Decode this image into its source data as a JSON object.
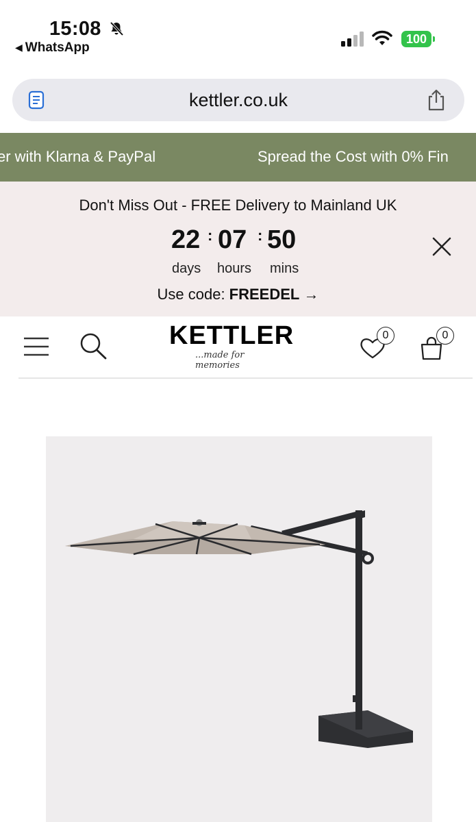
{
  "status_bar": {
    "time": "15:08",
    "back_app": "WhatsApp",
    "battery": "100",
    "icons": [
      "bell-muted-icon",
      "signal-icon",
      "wifi-icon",
      "battery-icon"
    ]
  },
  "browser": {
    "url": "kettler.co.uk",
    "reader_icon": "reader-mode-icon",
    "share_icon": "share-icon"
  },
  "marquee": {
    "item_1": "er with Klarna & PayPal",
    "item_2": "Spread the Cost with 0% Fin",
    "color": "#7a8862"
  },
  "promo": {
    "headline": "Don't Miss Out - FREE Delivery to Mainland UK",
    "countdown": {
      "days": "22",
      "hours": "07",
      "mins": "50",
      "days_label": "days",
      "hours_label": "hours",
      "mins_label": "mins",
      "separator": ":"
    },
    "code_prefix": "Use code: ",
    "code": "FREEDEL",
    "code_arrow": "→",
    "close_icon": "close-icon",
    "background": "#f3ecec"
  },
  "header": {
    "logo_text": "KETTLER",
    "tagline": "...made for memories",
    "wishlist_count": "0",
    "bag_count": "0",
    "icons": [
      "menu-icon",
      "search-icon",
      "heart-icon",
      "bag-icon"
    ]
  },
  "product": {
    "image": "cantilever-parasol-image"
  }
}
